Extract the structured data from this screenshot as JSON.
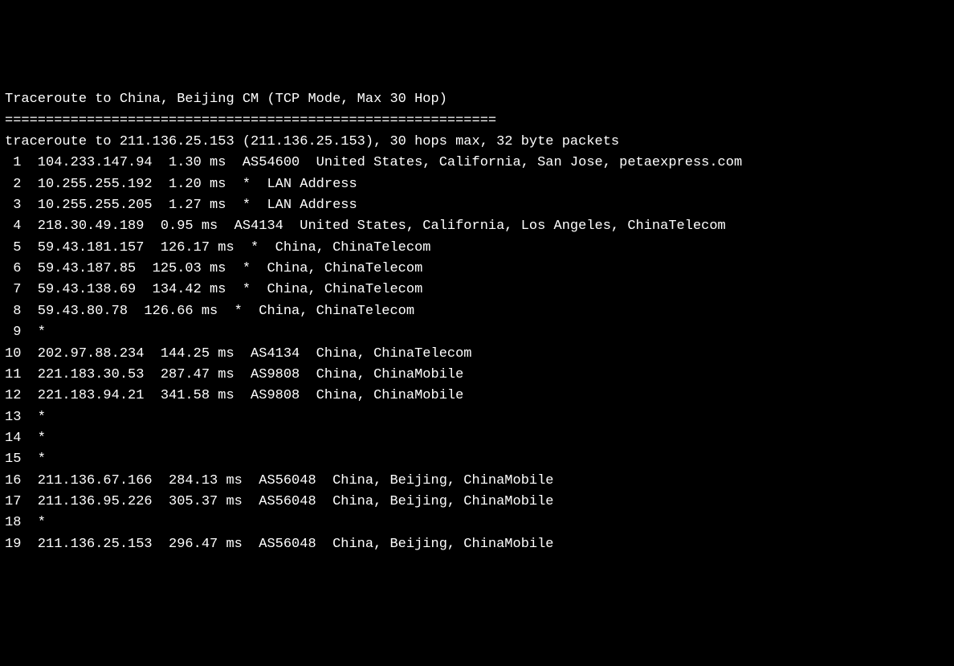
{
  "header": {
    "title": "Traceroute to China, Beijing CM (TCP Mode, Max 30 Hop)",
    "separator": "============================================================",
    "command": "traceroute to 211.136.25.153 (211.136.25.153), 30 hops max, 32 byte packets"
  },
  "hops": [
    {
      "num": " 1",
      "ip": "104.233.147.94",
      "rtt": "1.30 ms",
      "asn": "AS54600",
      "location": "United States, California, San Jose, petaexpress.com"
    },
    {
      "num": " 2",
      "ip": "10.255.255.192",
      "rtt": "1.20 ms",
      "asn": "*",
      "location": "LAN Address"
    },
    {
      "num": " 3",
      "ip": "10.255.255.205",
      "rtt": "1.27 ms",
      "asn": "*",
      "location": "LAN Address"
    },
    {
      "num": " 4",
      "ip": "218.30.49.189",
      "rtt": "0.95 ms",
      "asn": "AS4134",
      "location": "United States, California, Los Angeles, ChinaTelecom"
    },
    {
      "num": " 5",
      "ip": "59.43.181.157",
      "rtt": "126.17 ms",
      "asn": "*",
      "location": "China, ChinaTelecom"
    },
    {
      "num": " 6",
      "ip": "59.43.187.85",
      "rtt": "125.03 ms",
      "asn": "*",
      "location": "China, ChinaTelecom"
    },
    {
      "num": " 7",
      "ip": "59.43.138.69",
      "rtt": "134.42 ms",
      "asn": "*",
      "location": "China, ChinaTelecom"
    },
    {
      "num": " 8",
      "ip": "59.43.80.78",
      "rtt": "126.66 ms",
      "asn": "*",
      "location": "China, ChinaTelecom"
    },
    {
      "num": " 9",
      "ip": "*",
      "rtt": "",
      "asn": "",
      "location": ""
    },
    {
      "num": "10",
      "ip": "202.97.88.234",
      "rtt": "144.25 ms",
      "asn": "AS4134",
      "location": "China, ChinaTelecom"
    },
    {
      "num": "11",
      "ip": "221.183.30.53",
      "rtt": "287.47 ms",
      "asn": "AS9808",
      "location": "China, ChinaMobile"
    },
    {
      "num": "12",
      "ip": "221.183.94.21",
      "rtt": "341.58 ms",
      "asn": "AS9808",
      "location": "China, ChinaMobile"
    },
    {
      "num": "13",
      "ip": "*",
      "rtt": "",
      "asn": "",
      "location": ""
    },
    {
      "num": "14",
      "ip": "*",
      "rtt": "",
      "asn": "",
      "location": ""
    },
    {
      "num": "15",
      "ip": "*",
      "rtt": "",
      "asn": "",
      "location": ""
    },
    {
      "num": "16",
      "ip": "211.136.67.166",
      "rtt": "284.13 ms",
      "asn": "AS56048",
      "location": "China, Beijing, ChinaMobile"
    },
    {
      "num": "17",
      "ip": "211.136.95.226",
      "rtt": "305.37 ms",
      "asn": "AS56048",
      "location": "China, Beijing, ChinaMobile"
    },
    {
      "num": "18",
      "ip": "*",
      "rtt": "",
      "asn": "",
      "location": ""
    },
    {
      "num": "19",
      "ip": "211.136.25.153",
      "rtt": "296.47 ms",
      "asn": "AS56048",
      "location": "China, Beijing, ChinaMobile"
    }
  ]
}
